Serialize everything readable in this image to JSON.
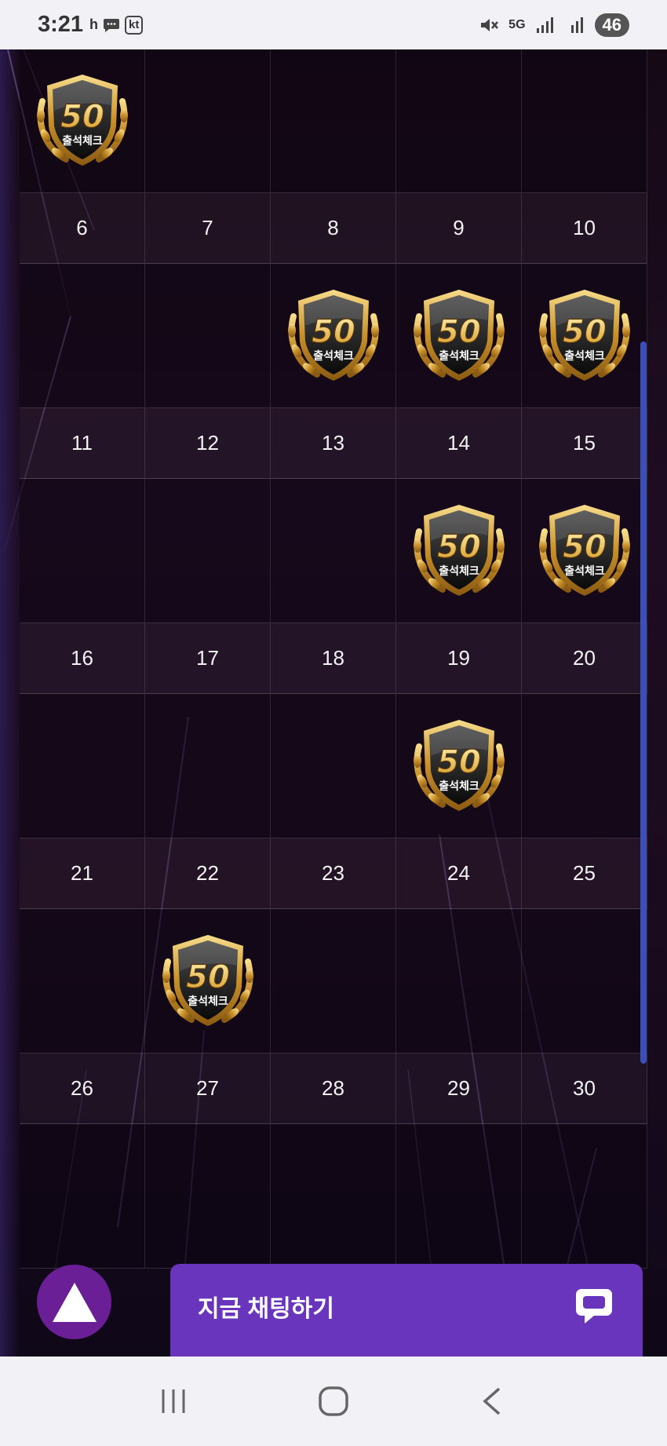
{
  "status_bar": {
    "time": "3:21",
    "indicator": "h",
    "carrier": "kt",
    "network": "5G",
    "battery": "46"
  },
  "calendar": {
    "stamp_label": "출석체크",
    "stamp_points": "50",
    "first_row": {
      "stamped": [
        true,
        false,
        false,
        false,
        false
      ]
    },
    "weeks": [
      {
        "days": [
          "6",
          "7",
          "8",
          "9",
          "10"
        ],
        "stamped": [
          false,
          false,
          true,
          true,
          true
        ]
      },
      {
        "days": [
          "11",
          "12",
          "13",
          "14",
          "15"
        ],
        "stamped": [
          false,
          false,
          false,
          true,
          true
        ]
      },
      {
        "days": [
          "16",
          "17",
          "18",
          "19",
          "20"
        ],
        "stamped": [
          false,
          false,
          false,
          true,
          false
        ]
      },
      {
        "days": [
          "21",
          "22",
          "23",
          "24",
          "25"
        ],
        "stamped": [
          false,
          true,
          false,
          false,
          false
        ]
      },
      {
        "days": [
          "26",
          "27",
          "28",
          "29",
          "30"
        ],
        "stamped": [
          false,
          false,
          false,
          false,
          false
        ]
      }
    ]
  },
  "chat": {
    "label": "지금 채팅하기"
  },
  "colors": {
    "accent": "#6a35bd",
    "top_button": "#6b1f96",
    "scrollbar": "#3b4fb8",
    "gold": "#d9a63a"
  },
  "icons": {
    "scroll_top": "triangle-up-icon",
    "chat": "chat-bubble-icon",
    "nav_recent": "recent-apps-icon",
    "nav_home": "home-icon",
    "nav_back": "back-icon"
  }
}
